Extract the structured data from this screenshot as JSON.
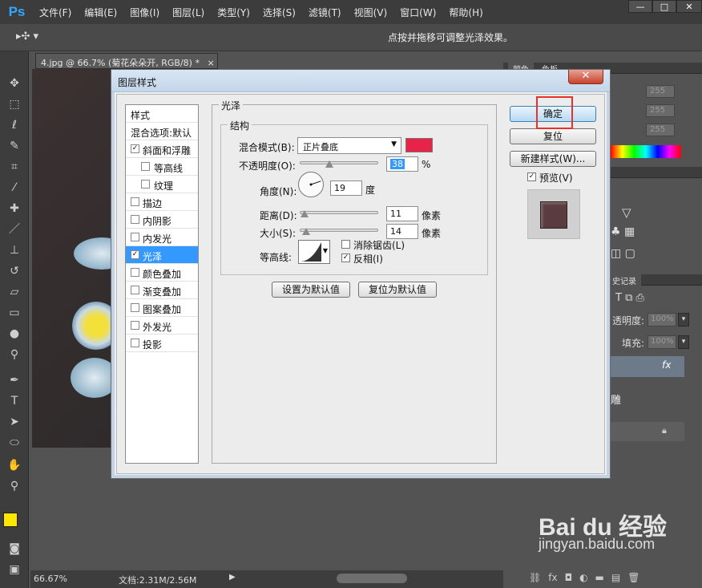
{
  "app": {
    "logo": "Ps"
  },
  "menu": [
    "文件(F)",
    "编辑(E)",
    "图像(I)",
    "图层(L)",
    "类型(Y)",
    "选择(S)",
    "滤镜(T)",
    "视图(V)",
    "窗口(W)",
    "帮助(H)"
  ],
  "window_controls": {
    "minimize": "—",
    "restore": "□",
    "close": "✕"
  },
  "options_bar": {
    "hint": "点按并拖移可调整光泽效果。"
  },
  "document": {
    "tab_title": "4.jpg @ 66.7% (菊花朵朵开, RGB/8) *",
    "tab_close": "×"
  },
  "status_bar": {
    "zoom": "66.67%",
    "doc_info": "文档:2.31M/2.56M"
  },
  "right_panel": {
    "color_tabs": [
      "颜色",
      "色板"
    ],
    "color_values": [
      "255",
      "255",
      "255"
    ],
    "history_tab": "史记录",
    "layers": {
      "opacity_label": "透明度:",
      "opacity_value": "100%",
      "fill_label": "填充:",
      "fill_value": "100%",
      "fx": "fx",
      "layer_fragment": "雕"
    }
  },
  "dialog": {
    "title": "图层样式",
    "close": "✕",
    "style_list": [
      {
        "label": "样式",
        "checkbox": false,
        "header": true
      },
      {
        "label": "混合选项:默认",
        "checkbox": false,
        "header": true
      },
      {
        "label": "斜面和浮雕",
        "checkbox": true,
        "checked": true
      },
      {
        "label": "等高线",
        "checkbox": true,
        "checked": false,
        "sub": true
      },
      {
        "label": "纹理",
        "checkbox": true,
        "checked": false,
        "sub": true
      },
      {
        "label": "描边",
        "checkbox": true,
        "checked": false
      },
      {
        "label": "内阴影",
        "checkbox": true,
        "checked": false
      },
      {
        "label": "内发光",
        "checkbox": true,
        "checked": false
      },
      {
        "label": "光泽",
        "checkbox": true,
        "checked": true,
        "selected": true
      },
      {
        "label": "颜色叠加",
        "checkbox": true,
        "checked": false
      },
      {
        "label": "渐变叠加",
        "checkbox": true,
        "checked": false
      },
      {
        "label": "图案叠加",
        "checkbox": true,
        "checked": false
      },
      {
        "label": "外发光",
        "checkbox": true,
        "checked": false
      },
      {
        "label": "投影",
        "checkbox": true,
        "checked": false
      }
    ],
    "section_title": "光泽",
    "structure_title": "结构",
    "blend_mode_label": "混合模式(B):",
    "blend_mode_value": "正片叠底",
    "color_swatch": "#e8234a",
    "opacity_label": "不透明度(O):",
    "opacity_value": "38",
    "opacity_unit": "%",
    "opacity_pct": 38,
    "angle_label": "角度(N):",
    "angle_value": "19",
    "angle_unit": "度",
    "distance_label": "距离(D):",
    "distance_value": "11",
    "distance_unit": "像素",
    "size_label": "大小(S):",
    "size_value": "14",
    "size_unit": "像素",
    "contour_label": "等高线:",
    "antialias_label": "消除锯齿(L)",
    "antialias_checked": false,
    "invert_label": "反相(I)",
    "invert_checked": true,
    "set_default": "设置为默认值",
    "reset_default": "复位为默认值",
    "ok": "确定",
    "reset": "复位",
    "new_style": "新建样式(W)...",
    "preview_label": "预览(V)",
    "preview_checked": true
  },
  "watermark": {
    "brand": "Bai du 经验",
    "url": "jingyan.baidu.com"
  },
  "colors": {
    "accent": "#3399ff",
    "highlight_box": "#e8322b",
    "foreground": "#ffe600",
    "background": "#ffffff"
  }
}
